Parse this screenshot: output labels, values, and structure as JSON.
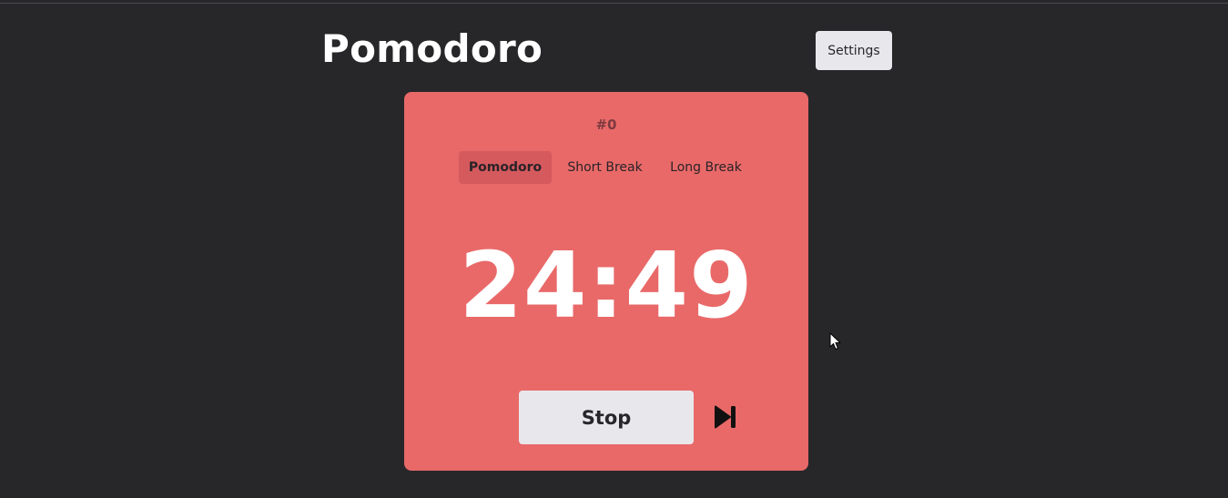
{
  "header": {
    "title": "Pomodoro",
    "settings_label": "Settings"
  },
  "timer": {
    "session_count": "#0",
    "tabs": [
      {
        "label": "Pomodoro",
        "active": true
      },
      {
        "label": "Short Break",
        "active": false
      },
      {
        "label": "Long Break",
        "active": false
      }
    ],
    "time_remaining": "24:49",
    "stop_label": "Stop",
    "skip_icon": "skip-forward-icon"
  },
  "colors": {
    "page_background": "#27272a",
    "card_background": "#e96969",
    "active_tab": "#d45a5e",
    "button_background": "#e8e8ec"
  }
}
